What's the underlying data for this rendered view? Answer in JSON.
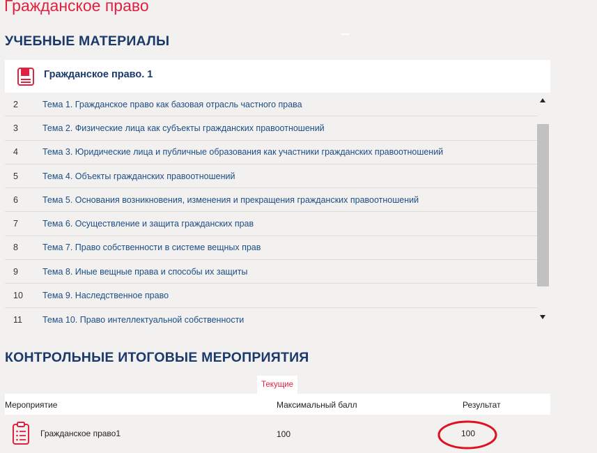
{
  "page": {
    "title": "Гражданское право"
  },
  "materials": {
    "section_title": "УЧЕБНЫЕ МАТЕРИАЛЫ",
    "course": {
      "name": "Гражданское право. 1",
      "icon": "book-icon"
    },
    "topics": [
      {
        "num": "2",
        "title": "Тема 1. Гражданское право как базовая отрасль частного права"
      },
      {
        "num": "3",
        "title": "Тема 2. Физические лица как субъекты гражданских правоотношений"
      },
      {
        "num": "4",
        "title": "Тема 3. Юридические лица и публичные образования как участники гражданских правоотношений"
      },
      {
        "num": "5",
        "title": "Тема 4. Объекты гражданских правоотношений"
      },
      {
        "num": "6",
        "title": "Тема 5. Основания возникновения, изменения и прекращения гражданских правоотношений"
      },
      {
        "num": "7",
        "title": "Тема 6. Осуществление и защита гражданских прав"
      },
      {
        "num": "8",
        "title": "Тема 7. Право собственности в системе вещных прав"
      },
      {
        "num": "9",
        "title": "Тема 8. Иные вещные права и способы их защиты"
      },
      {
        "num": "10",
        "title": "Тема 9. Наследственное право"
      },
      {
        "num": "11",
        "title": "Тема 10. Право интеллектуальной собственности"
      }
    ]
  },
  "events": {
    "section_title": "КОНТРОЛЬНЫЕ ИТОГОВЫЕ МЕРОПРИЯТИЯ",
    "tab_current": "Текущие",
    "columns": {
      "event": "Мероприятие",
      "max_score": "Максимальный балл",
      "result": "Результат"
    },
    "rows": [
      {
        "name": "Гражданское право1",
        "max_score": "100",
        "result": "100",
        "icon": "clipboard-icon"
      }
    ]
  },
  "colors": {
    "accent_red": "#e0213f",
    "heading_navy": "#1b3a6b",
    "link_blue": "#1d4d86",
    "annotation_red": "#e0101e"
  }
}
